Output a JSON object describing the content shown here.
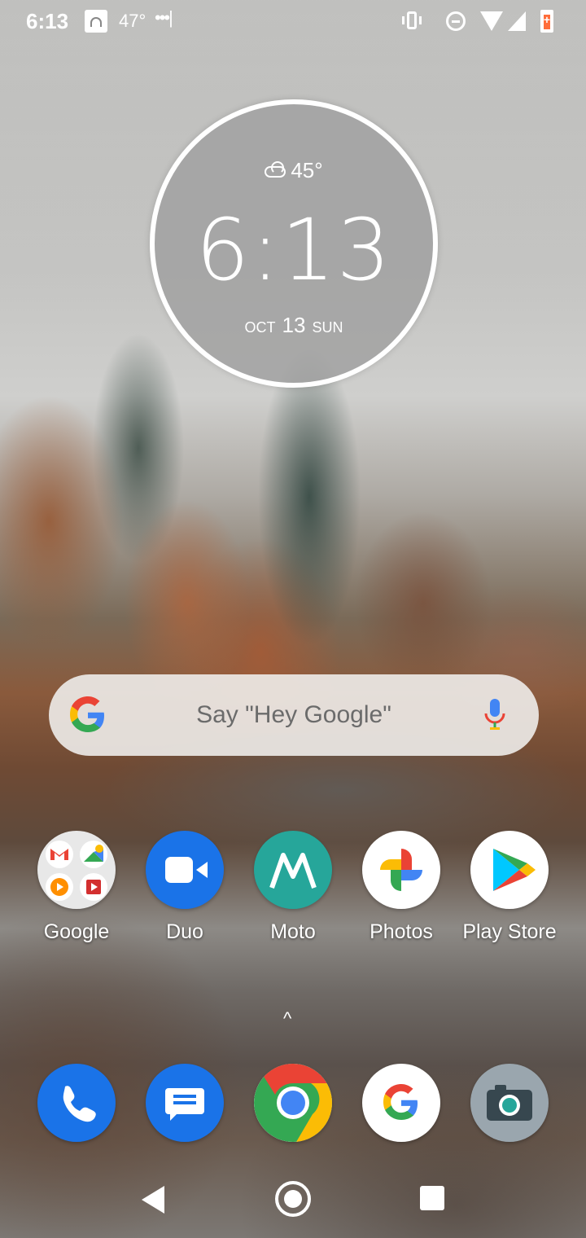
{
  "status_bar": {
    "time": "6:13",
    "temperature": "47°",
    "dots": "•••|",
    "icons": [
      "photo-notification-icon",
      "vibrate-icon",
      "do-not-disturb-icon",
      "wifi-icon",
      "cell-signal-icon",
      "battery-charging-icon"
    ]
  },
  "clock_widget": {
    "weather_temp": "45°",
    "weather_icon": "cloud-icon",
    "time": "6:13",
    "month": "OCT",
    "day": "13",
    "weekday": "SUN"
  },
  "search_bar": {
    "hint": "Say \"Hey Google\"",
    "icons": [
      "google-g-icon",
      "microphone-icon"
    ]
  },
  "apps": [
    {
      "label": "Google",
      "icon": "google-folder-icon"
    },
    {
      "label": "Duo",
      "icon": "duo-icon"
    },
    {
      "label": "Moto",
      "icon": "moto-icon"
    },
    {
      "label": "Photos",
      "icon": "photos-icon"
    },
    {
      "label": "Play Store",
      "icon": "play-store-icon"
    }
  ],
  "app_drawer_handle": "^",
  "dock": [
    {
      "icon": "phone-icon"
    },
    {
      "icon": "messages-icon"
    },
    {
      "icon": "chrome-icon"
    },
    {
      "icon": "google-icon"
    },
    {
      "icon": "camera-icon"
    }
  ],
  "nav_bar": {
    "icons": [
      "back-icon",
      "home-icon",
      "recents-icon"
    ]
  },
  "colors": {
    "google_blue": "#4285F4",
    "google_red": "#EA4335",
    "google_yellow": "#FBBC05",
    "google_green": "#34A853",
    "duo_blue": "#1a73e8",
    "moto_teal": "#26a69a"
  }
}
